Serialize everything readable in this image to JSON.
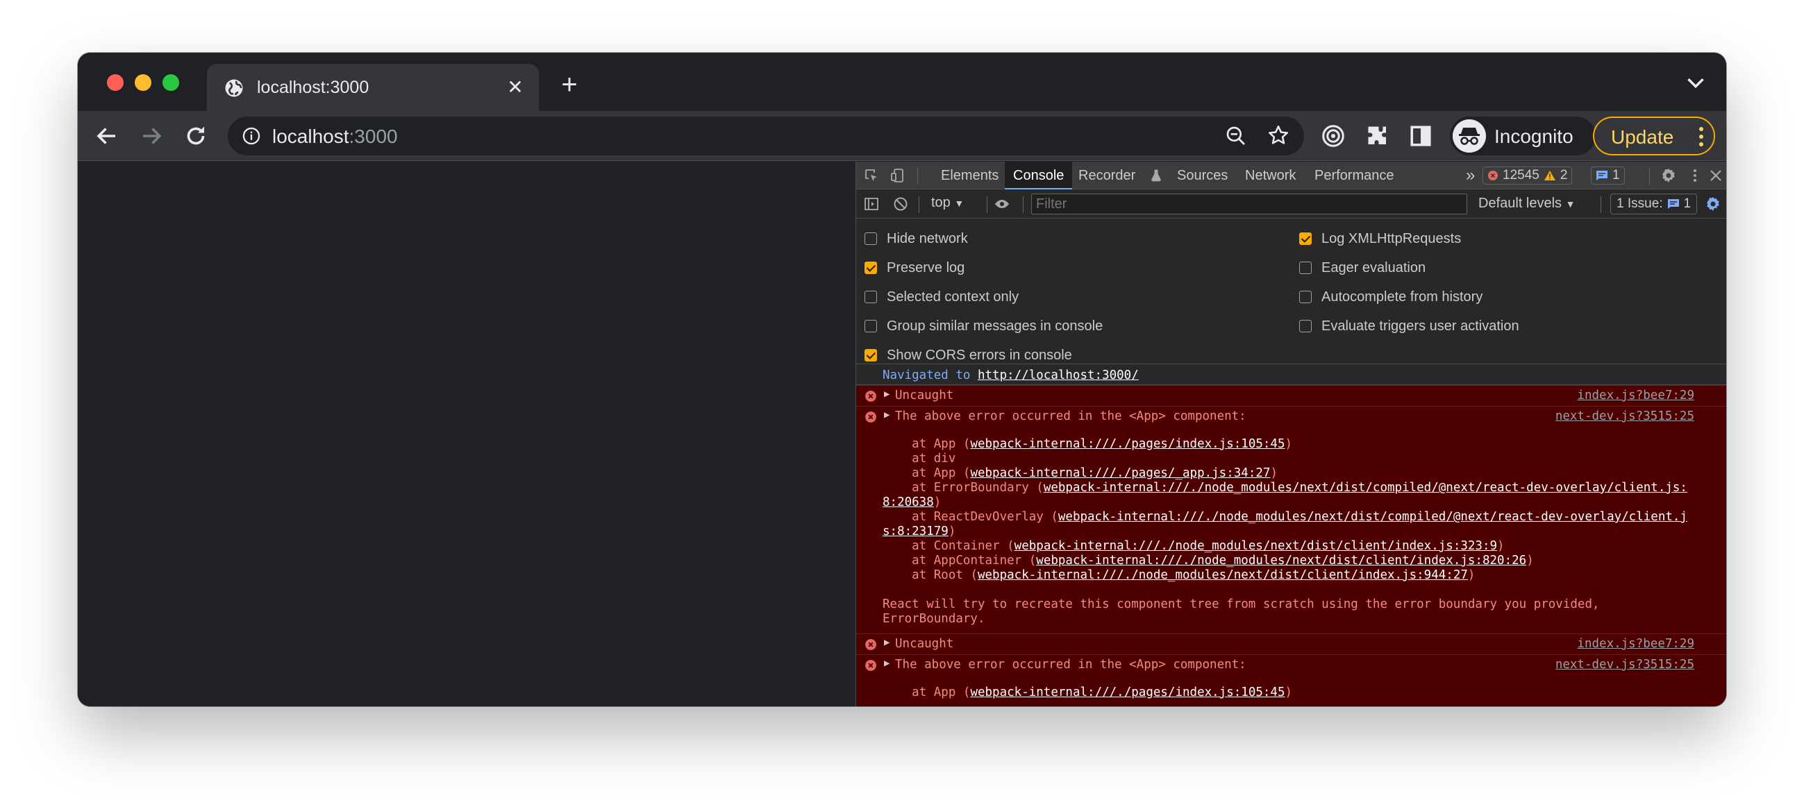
{
  "browser": {
    "tab_title": "localhost:3000",
    "url_host": "localhost",
    "url_port": ":3000",
    "profile_label": "Incognito",
    "update_label": "Update"
  },
  "devtools": {
    "tabs": [
      "Elements",
      "Console",
      "Recorder",
      "Sources",
      "Network",
      "Performance"
    ],
    "error_count": "12545",
    "warning_count": "2",
    "message_count": "1",
    "context": "top",
    "filter_placeholder": "Filter",
    "levels": "Default levels",
    "issues_label": "1 Issue:",
    "issues_count": "1",
    "options": [
      {
        "label": "Hide network",
        "checked": false
      },
      {
        "label": "Log XMLHttpRequests",
        "checked": true
      },
      {
        "label": "Preserve log",
        "checked": true
      },
      {
        "label": "Eager evaluation",
        "checked": false
      },
      {
        "label": "Selected context only",
        "checked": false
      },
      {
        "label": "Autocomplete from history",
        "checked": false
      },
      {
        "label": "Group similar messages in console",
        "checked": false
      },
      {
        "label": "Evaluate triggers user activation",
        "checked": false
      },
      {
        "label": "Show CORS errors in console",
        "checked": true
      }
    ]
  },
  "console": {
    "navigated_prefix": "Navigated to ",
    "navigated_url": "http://localhost:3000/",
    "uncaught": "Uncaught",
    "uncaught_src": "index.js?bee7:29",
    "above_error": "The above error occurred in the <App> component:",
    "above_error_src": "next-dev.js?3515:25",
    "at_app": "at App (",
    "link_index": "webpack-internal:///./pages/index.js:105:45",
    "at_div": "at div",
    "link_app": "webpack-internal:///./pages/_app.js:34:27",
    "at_errorboundary": "at ErrorBoundary (",
    "link_eb_1": "webpack-internal:///./node_modules/next/dist/compiled/@next/react-dev-overlay/client.js:",
    "link_eb_2": "8:20638",
    "at_rdo": "at ReactDevOverlay (",
    "link_rdo_1": "webpack-internal:///./node_modules/next/dist/compiled/@next/react-dev-overlay/client.j",
    "link_rdo_2": "s:8:23179",
    "at_container": "at Container (",
    "link_container": "webpack-internal:///./node_modules/next/dist/client/index.js:323:9",
    "at_appcontainer": "at AppContainer (",
    "link_appcontainer": "webpack-internal:///./node_modules/next/dist/client/index.js:820:26",
    "at_root": "at Root (",
    "link_root": "webpack-internal:///./node_modules/next/dist/client/index.js:944:27",
    "react_msg_1": "React will try to recreate this component tree from scratch using the error boundary you provided,",
    "react_msg_2": "ErrorBoundary."
  },
  "colors": {
    "accent_orange": "#f9ab00",
    "error_bg": "#4e0000",
    "error_text": "#f28b82",
    "link_blue": "#7cacf8"
  }
}
